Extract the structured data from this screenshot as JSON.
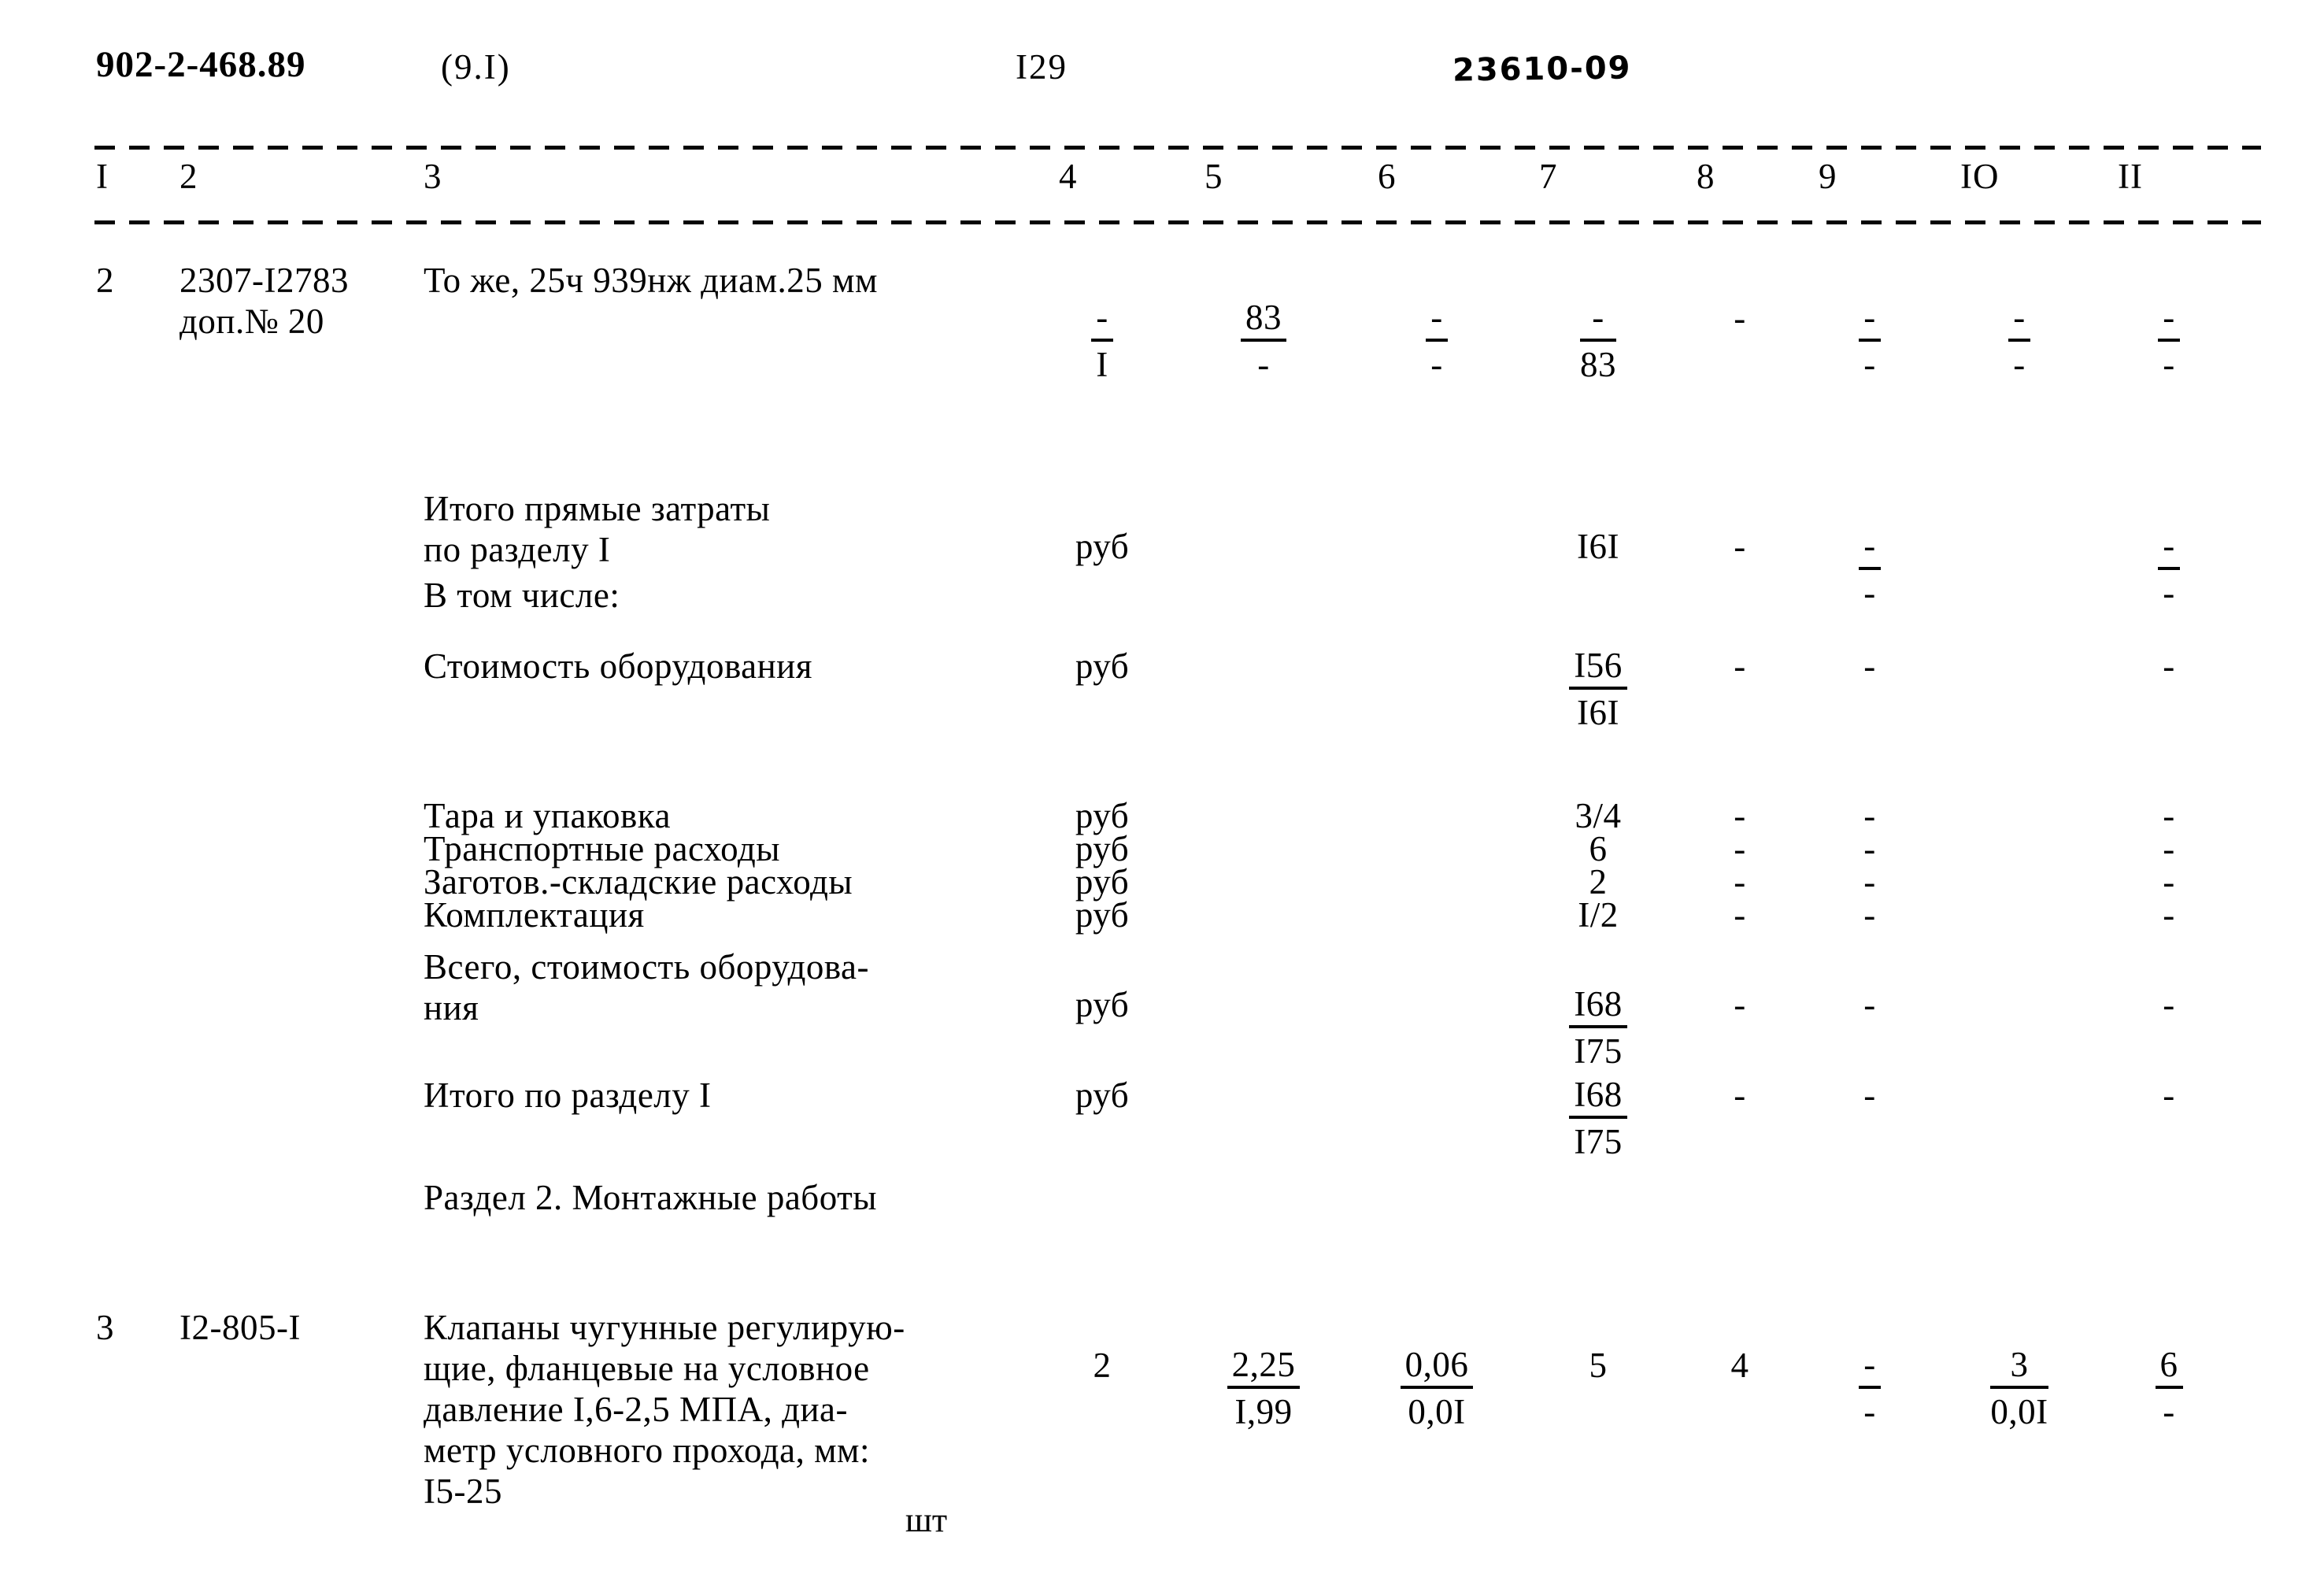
{
  "header": {
    "doc_code": "902-2-468.89",
    "sheet_ref": "(9.I)",
    "page_no": "I29",
    "stamp": "23610-09"
  },
  "column_headers": [
    "I",
    "2",
    "3",
    "4",
    "5",
    "6",
    "7",
    "8",
    "9",
    "IO",
    "II"
  ],
  "rows": [
    {
      "no": "2",
      "code": "2307-I2783\nдоп.№ 20",
      "desc": "То же, 25ч 939нж диам.25 мм",
      "c4": {
        "type": "frac",
        "num": "-",
        "den": "I"
      },
      "c5": {
        "type": "frac",
        "num": "83",
        "den": "-"
      },
      "c6": {
        "type": "frac",
        "num": "-",
        "den": "-"
      },
      "c7": {
        "type": "frac",
        "num": "-",
        "den": "83"
      },
      "c8": {
        "type": "plain",
        "val": "-"
      },
      "c9": {
        "type": "frac",
        "num": "-",
        "den": "-"
      },
      "c10": {
        "type": "frac",
        "num": "-",
        "den": "-"
      },
      "c11": {
        "type": "frac",
        "num": "-",
        "den": "-"
      }
    },
    {
      "no": "",
      "code": "",
      "desc": "Итого прямые затраты\nпо разделу I",
      "c4": {
        "type": "plain",
        "val": "руб"
      },
      "c5": {
        "type": "plain",
        "val": ""
      },
      "c6": {
        "type": "plain",
        "val": ""
      },
      "c7": {
        "type": "plain",
        "val": "I6I"
      },
      "c8": {
        "type": "plain",
        "val": "-"
      },
      "c9": {
        "type": "frac",
        "num": "-",
        "den": "-"
      },
      "c10": {
        "type": "plain",
        "val": ""
      },
      "c11": {
        "type": "frac",
        "num": "-",
        "den": "-"
      }
    },
    {
      "no": "",
      "code": "",
      "desc": "В том числе:",
      "c4": {
        "type": "plain",
        "val": ""
      },
      "c5": {
        "type": "plain",
        "val": ""
      },
      "c6": {
        "type": "plain",
        "val": ""
      },
      "c7": {
        "type": "plain",
        "val": ""
      },
      "c8": {
        "type": "plain",
        "val": ""
      },
      "c9": {
        "type": "plain",
        "val": ""
      },
      "c10": {
        "type": "plain",
        "val": ""
      },
      "c11": {
        "type": "plain",
        "val": ""
      }
    },
    {
      "no": "",
      "code": "",
      "desc": "Стоимость оборудования",
      "c4": {
        "type": "plain",
        "val": "руб"
      },
      "c5": {
        "type": "plain",
        "val": ""
      },
      "c6": {
        "type": "plain",
        "val": ""
      },
      "c7": {
        "type": "frac",
        "num": "I56",
        "den": "I6I"
      },
      "c8": {
        "type": "plain",
        "val": "-"
      },
      "c9": {
        "type": "plain",
        "val": "-"
      },
      "c10": {
        "type": "plain",
        "val": ""
      },
      "c11": {
        "type": "plain",
        "val": "-"
      }
    },
    {
      "no": "",
      "code": "",
      "desc": "Тара и упаковка",
      "c4": {
        "type": "plain",
        "val": "руб"
      },
      "c5": {
        "type": "plain",
        "val": ""
      },
      "c6": {
        "type": "plain",
        "val": ""
      },
      "c7": {
        "type": "plain",
        "val": "3/4"
      },
      "c8": {
        "type": "plain",
        "val": "-"
      },
      "c9": {
        "type": "plain",
        "val": "-"
      },
      "c10": {
        "type": "plain",
        "val": ""
      },
      "c11": {
        "type": "plain",
        "val": "-"
      }
    },
    {
      "no": "",
      "code": "",
      "desc": "Транспортные расходы",
      "c4": {
        "type": "plain",
        "val": "руб"
      },
      "c5": {
        "type": "plain",
        "val": ""
      },
      "c6": {
        "type": "plain",
        "val": ""
      },
      "c7": {
        "type": "plain",
        "val": "6"
      },
      "c8": {
        "type": "plain",
        "val": "-"
      },
      "c9": {
        "type": "plain",
        "val": "-"
      },
      "c10": {
        "type": "plain",
        "val": ""
      },
      "c11": {
        "type": "plain",
        "val": "-"
      }
    },
    {
      "no": "",
      "code": "",
      "desc": "Заготов.-складские расходы",
      "c4": {
        "type": "plain",
        "val": "руб"
      },
      "c5": {
        "type": "plain",
        "val": ""
      },
      "c6": {
        "type": "plain",
        "val": ""
      },
      "c7": {
        "type": "plain",
        "val": "2"
      },
      "c8": {
        "type": "plain",
        "val": "-"
      },
      "c9": {
        "type": "plain",
        "val": "-"
      },
      "c10": {
        "type": "plain",
        "val": ""
      },
      "c11": {
        "type": "plain",
        "val": "-"
      }
    },
    {
      "no": "",
      "code": "",
      "desc": "Комплектация",
      "c4": {
        "type": "plain",
        "val": "руб"
      },
      "c5": {
        "type": "plain",
        "val": ""
      },
      "c6": {
        "type": "plain",
        "val": ""
      },
      "c7": {
        "type": "plain",
        "val": "I/2"
      },
      "c8": {
        "type": "plain",
        "val": "-"
      },
      "c9": {
        "type": "plain",
        "val": "-"
      },
      "c10": {
        "type": "plain",
        "val": ""
      },
      "c11": {
        "type": "plain",
        "val": "-"
      }
    },
    {
      "no": "",
      "code": "",
      "desc": "Всего, стоимость оборудова-\nния",
      "c4": {
        "type": "plain",
        "val": "руб"
      },
      "c5": {
        "type": "plain",
        "val": ""
      },
      "c6": {
        "type": "plain",
        "val": ""
      },
      "c7": {
        "type": "frac",
        "num": "I68",
        "den": "I75"
      },
      "c8": {
        "type": "plain",
        "val": "-"
      },
      "c9": {
        "type": "plain",
        "val": "-"
      },
      "c10": {
        "type": "plain",
        "val": ""
      },
      "c11": {
        "type": "plain",
        "val": "-"
      }
    },
    {
      "no": "",
      "code": "",
      "desc": "Итого по разделу I",
      "c4": {
        "type": "plain",
        "val": "руб"
      },
      "c5": {
        "type": "plain",
        "val": ""
      },
      "c6": {
        "type": "plain",
        "val": ""
      },
      "c7": {
        "type": "frac",
        "num": "I68",
        "den": "I75"
      },
      "c8": {
        "type": "plain",
        "val": "-"
      },
      "c9": {
        "type": "plain",
        "val": "-"
      },
      "c10": {
        "type": "plain",
        "val": ""
      },
      "c11": {
        "type": "plain",
        "val": "-"
      }
    },
    {
      "no": "",
      "code": "",
      "desc": "Раздел 2. Монтажные работы",
      "c4": {
        "type": "plain",
        "val": ""
      },
      "c5": {
        "type": "plain",
        "val": ""
      },
      "c6": {
        "type": "plain",
        "val": ""
      },
      "c7": {
        "type": "plain",
        "val": ""
      },
      "c8": {
        "type": "plain",
        "val": ""
      },
      "c9": {
        "type": "plain",
        "val": ""
      },
      "c10": {
        "type": "plain",
        "val": ""
      },
      "c11": {
        "type": "plain",
        "val": ""
      }
    },
    {
      "no": "3",
      "code": "I2-805-I",
      "desc": "Клапаны чугунные регулирую-\nщие, фланцевые на условное\nдавление I,6-2,5 МПА, диа-\nметр условного прохода, мм:\nI5-25",
      "c4": {
        "type": "plain",
        "val": "2"
      },
      "c5": {
        "type": "frac",
        "num": "2,25",
        "den": "I,99"
      },
      "c6": {
        "type": "frac",
        "num": "0,06",
        "den": "0,0I"
      },
      "c7": {
        "type": "plain",
        "val": "5"
      },
      "c8": {
        "type": "plain",
        "val": "4"
      },
      "c9": {
        "type": "frac",
        "num": "-",
        "den": "-"
      },
      "c10": {
        "type": "frac",
        "num": "3",
        "den": "0,0I"
      },
      "c11": {
        "type": "frac",
        "num": "6",
        "den": "-"
      }
    }
  ],
  "footer_unit": "шт"
}
